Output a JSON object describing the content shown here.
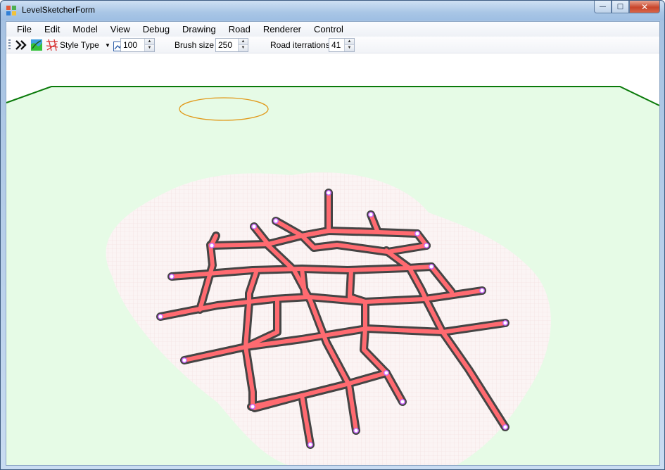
{
  "window": {
    "title": "LevelSketcherForm",
    "caption_buttons": {
      "minimize": "—",
      "maximize": "□",
      "close": "✕"
    }
  },
  "menu": {
    "items": [
      "File",
      "Edit",
      "Model",
      "View",
      "Debug",
      "Drawing",
      "Road",
      "Renderer",
      "Control"
    ]
  },
  "toolbar": {
    "icons": [
      "road-tool-icon",
      "terrain-tool-icon",
      "style-tool-icon",
      "zoom-icon"
    ],
    "style_type_label": "Style Type",
    "zoom_value": "100",
    "brush_size_label": "Brush size",
    "brush_size_value": "250",
    "road_iterations_label": "Road iterrations",
    "road_iterations_value": "41"
  },
  "scene": {
    "ground_color": "#e6fbe6",
    "horizon_color": "#0a7a0a",
    "terrain_patch_color": "#fbf4f4",
    "road_fill_color": "#ff6a70",
    "road_edge_color": "#454545",
    "node_color": "#cc66ff",
    "selection_ellipse_color": "#e19a1c"
  }
}
